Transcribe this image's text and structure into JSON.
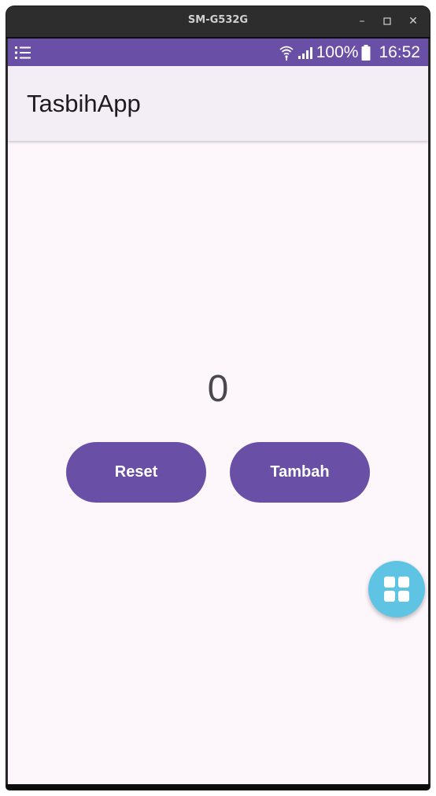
{
  "window": {
    "title": "SM-G532G",
    "controls": {
      "minimize": "–",
      "maximize": "☐",
      "close": "✕"
    }
  },
  "status_bar": {
    "battery_percent": "100%",
    "time": "16:52",
    "color": "#6a4fa6",
    "icons": [
      "menu-list-icon",
      "wifi-icon",
      "signal-icon",
      "battery-icon"
    ]
  },
  "app_bar": {
    "title": "TasbihApp"
  },
  "main": {
    "counter_value": "0",
    "reset_label": "Reset",
    "add_label": "Tambah",
    "button_color": "#6a4fa6"
  },
  "fab": {
    "icon": "grid-icon",
    "color": "#5fc3e4"
  }
}
